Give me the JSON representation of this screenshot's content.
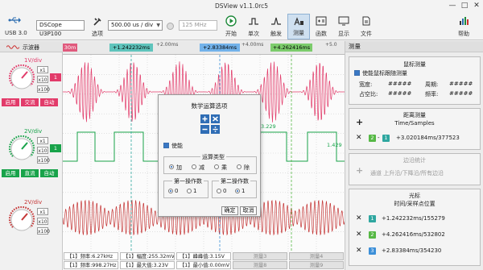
{
  "window": {
    "title": "DSView v1.1.0rc5",
    "minimize": "—",
    "maximize": "□",
    "close": "✕"
  },
  "toolbar": {
    "usb_label": "USB 3.0",
    "device_value": "DSCope U3P100",
    "options_label": "选项",
    "timebase_value": "500.00 us / div",
    "samplerate_value": "125 MHz",
    "buttons": {
      "start": "开始",
      "single": "单次",
      "trigger": "触发",
      "measure": "测量",
      "math": "函数",
      "display": "显示",
      "file": "文件",
      "help": "帮助"
    }
  },
  "left_panel": {
    "header": "示波器",
    "channels": [
      {
        "scale": "1V/div",
        "index": "1",
        "mult1": "x1",
        "mult2": "x10",
        "mult3": "x100",
        "enable": "启用",
        "coupling": "交流",
        "auto": "自动",
        "color": "#e23b6a"
      },
      {
        "scale": "2V/div",
        "index": "1",
        "mult1": "x1",
        "mult2": "x10",
        "mult3": "x100",
        "enable": "启用",
        "coupling": "直流",
        "auto": "自动",
        "color": "#18a34a"
      },
      {
        "scale": "2V/div",
        "index": "",
        "mult1": "x1",
        "mult2": "x10",
        "mult3": "x100",
        "enable": "",
        "coupling": "",
        "auto": "",
        "color": "#c53636"
      }
    ]
  },
  "scope": {
    "ruler": {
      "start_tag": "30m",
      "ticks": [
        "+2.00ms",
        "+4.00ms",
        "+5.0"
      ],
      "cursors": [
        {
          "label": "+1.242232ms",
          "index": "1",
          "color": "#2fa7a0"
        },
        {
          "label": "+2.83384ms",
          "index": "3",
          "color": "#3c8fd8"
        },
        {
          "label": "+4.262416ms",
          "index": "2",
          "color": "#56b845"
        }
      ]
    },
    "trace_labels": {
      "ch2_level": "3.229",
      "ch2_right": "1.429"
    },
    "measure_rows": [
      [
        "【1】频率:6.27kHz",
        "【1】幅度:255.32mV",
        "【1】峰峰值:3.15V",
        "测量3",
        "测量4"
      ],
      [
        "【1】频率:998.27Hz",
        "【1】最大值:3.23V",
        "【1】最小值:0.00mV",
        "测量8",
        "测量9"
      ]
    ]
  },
  "right_panel": {
    "header": "测量",
    "cursor_measure": {
      "title": "鼠标测量",
      "enable_label": "使能鼠标跟随测量",
      "width_label": "宽度:",
      "width_value": "#####",
      "period_label": "周期:",
      "period_value": "#####",
      "duty_label": "占空比:",
      "duty_value": "#####",
      "freq_label": "频率:",
      "freq_value": "#####"
    },
    "distance_measure": {
      "title": "距离测量",
      "subtitle": "Time/Samples",
      "row": {
        "from": "2",
        "to": "1",
        "value": "+3.020184ms/377523"
      }
    },
    "edge_stats": {
      "title": "边沿统计",
      "row": "通道    上升沿/下降沿/所有边沿"
    },
    "cursors": {
      "title": "光标",
      "subtitle": "时间/采样点位置",
      "rows": [
        {
          "index": "1",
          "value": "+1.242232ms/155279",
          "color": "#2fa7a0"
        },
        {
          "index": "2",
          "value": "+4.262416ms/532802",
          "color": "#56b845"
        },
        {
          "index": "3",
          "value": "+2.83384ms/354230",
          "color": "#3c8fd8"
        }
      ]
    }
  },
  "dialog": {
    "title": "数学运算选项",
    "enable_label": "使能",
    "op_group": "运算类型",
    "ops": [
      "加",
      "减",
      "乘",
      "除"
    ],
    "first_operand": "第一操作数",
    "second_operand": "第二操作数",
    "operand_options": [
      "0",
      "1"
    ],
    "ok": "确定",
    "cancel": "取消"
  }
}
